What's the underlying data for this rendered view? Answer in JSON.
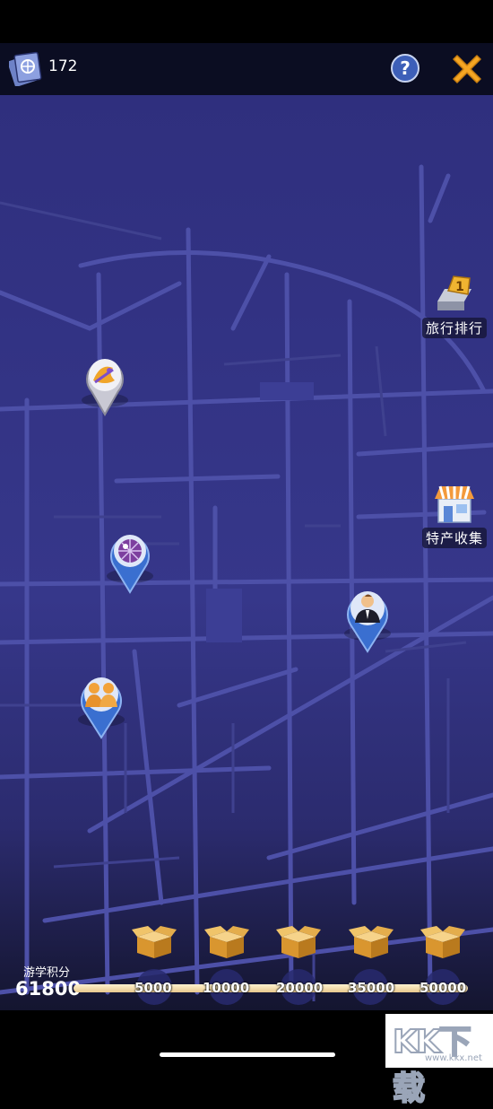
{
  "header": {
    "passport_count": "172",
    "help_icon": "question-mark-icon",
    "close_icon": "close-x-icon"
  },
  "side_buttons": {
    "ranking_label": "旅行排行",
    "specialty_label": "特产收集"
  },
  "pins": [
    {
      "name": "dragon-dance-pin",
      "icon": "dragon-icon"
    },
    {
      "name": "disco-ball-pin",
      "icon": "disco-ball-icon"
    },
    {
      "name": "businessman-pin",
      "icon": "businessman-icon"
    },
    {
      "name": "couple-pin",
      "icon": "couple-icon"
    }
  ],
  "score": {
    "label": "游学积分",
    "value": "61800"
  },
  "milestones": [
    "5000",
    "10000",
    "20000",
    "35000",
    "50000"
  ],
  "watermark": {
    "text": "KK下载",
    "url": "www.kkx.net"
  },
  "colors": {
    "map_bg": "#34358a",
    "road": "#5457b0",
    "header_bg": "#0b0d22",
    "pin_blue": "#3a6fd0",
    "close_orange": "#f5a623"
  }
}
